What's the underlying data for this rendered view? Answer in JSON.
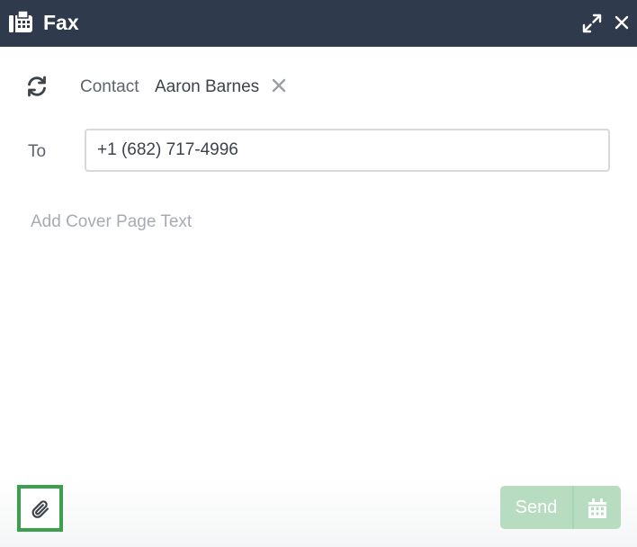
{
  "window": {
    "title": "Fax",
    "header_color": "#2f3a4d"
  },
  "icons": {
    "title_icon": "fax-icon",
    "expand": "expand-icon",
    "close": "close-icon",
    "sync": "refresh-icon",
    "remove_contact": "close-icon",
    "attach": "paperclip-icon",
    "schedule": "calendar-icon"
  },
  "contact": {
    "label": "Contact",
    "name": "Aaron Barnes"
  },
  "to": {
    "label": "To",
    "value": "+1 (682) 717-4996"
  },
  "cover_page": {
    "placeholder": "Add Cover Page Text",
    "value": ""
  },
  "footer": {
    "send_label": "Send",
    "send_enabled": false,
    "send_color": "#b7dcbf",
    "attach_highlight_color": "#3aa04c"
  }
}
